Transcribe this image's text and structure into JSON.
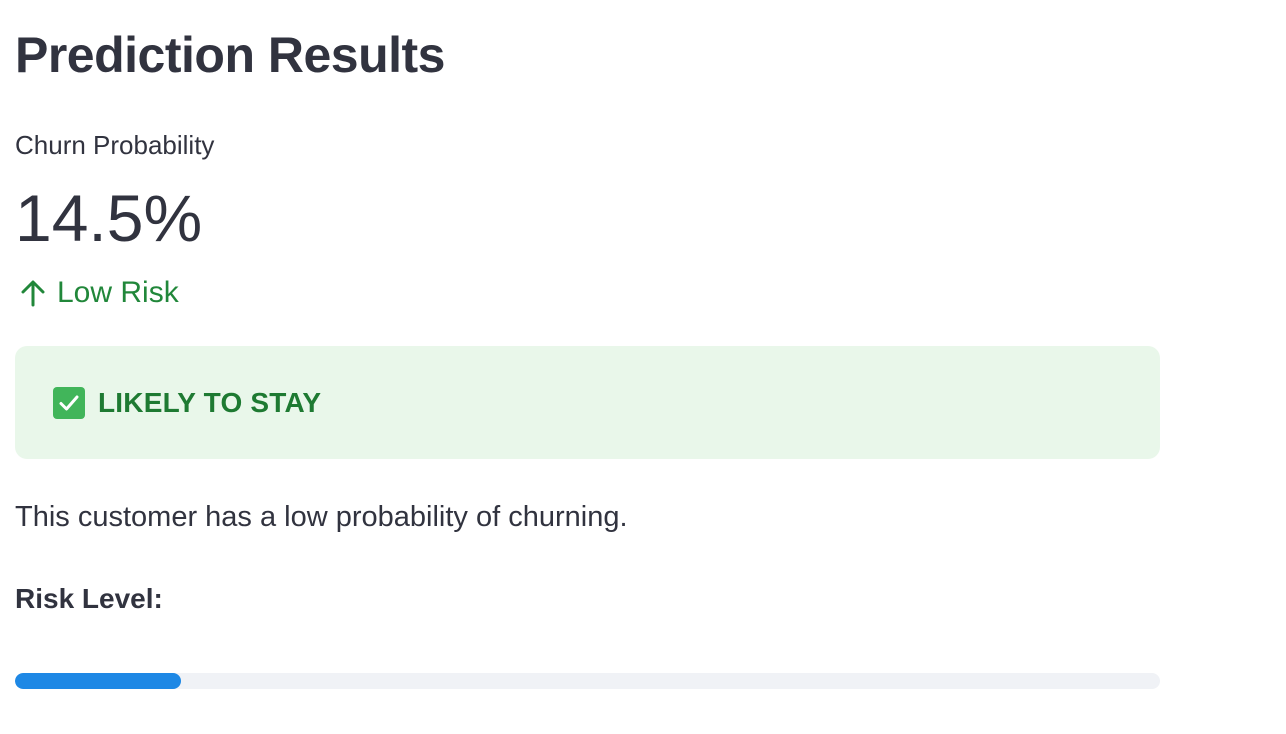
{
  "page": {
    "title": "Prediction Results"
  },
  "metric": {
    "label": "Churn Probability",
    "value": "14.5%",
    "delta_icon": "arrow-up-icon",
    "delta_text": "Low Risk",
    "delta_color": "#21873a"
  },
  "alert": {
    "icon": "check-mark-button-icon",
    "text": "LIKELY TO STAY",
    "background": "#e9f7ea",
    "text_color": "#1e7a32"
  },
  "description": "This customer has a low probability of churning.",
  "risk": {
    "label": "Risk Level:",
    "progress_fraction": 0.145,
    "fill_color": "#1e88e5"
  }
}
